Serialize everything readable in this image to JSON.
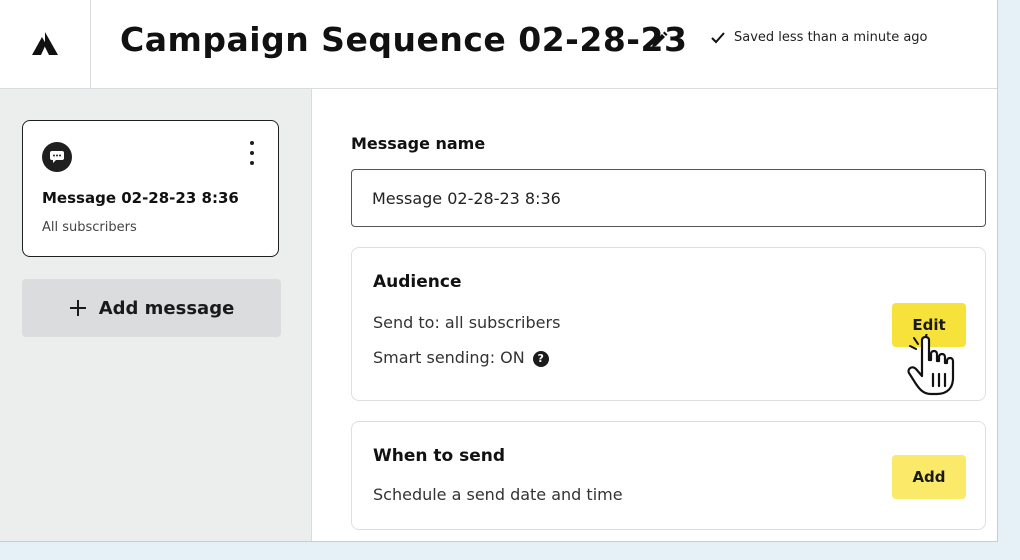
{
  "header": {
    "title": "Campaign Sequence 02-28-23",
    "saved_status": "Saved less than a minute ago"
  },
  "sidebar": {
    "message_card": {
      "title": "Message 02-28-23 8:36",
      "subtitle": "All subscribers"
    },
    "add_message_label": "Add message"
  },
  "main": {
    "message_name_label": "Message name",
    "message_name_value": "Message 02-28-23 8:36",
    "audience": {
      "title": "Audience",
      "send_to": "Send to: all subscribers",
      "smart_sending": "Smart sending: ON",
      "edit_label": "Edit"
    },
    "when_to_send": {
      "title": "When to send",
      "description": "Schedule a send date and time",
      "add_label": "Add"
    }
  },
  "colors": {
    "accent_yellow": "#f7e13b",
    "background": "#e6f1f7",
    "sidebar": "#eceded"
  },
  "icons": [
    "logo-icon",
    "pencil-icon",
    "check-icon",
    "chat-message-icon",
    "kebab-menu-icon",
    "plus-icon",
    "help-icon",
    "hand-cursor-icon"
  ]
}
